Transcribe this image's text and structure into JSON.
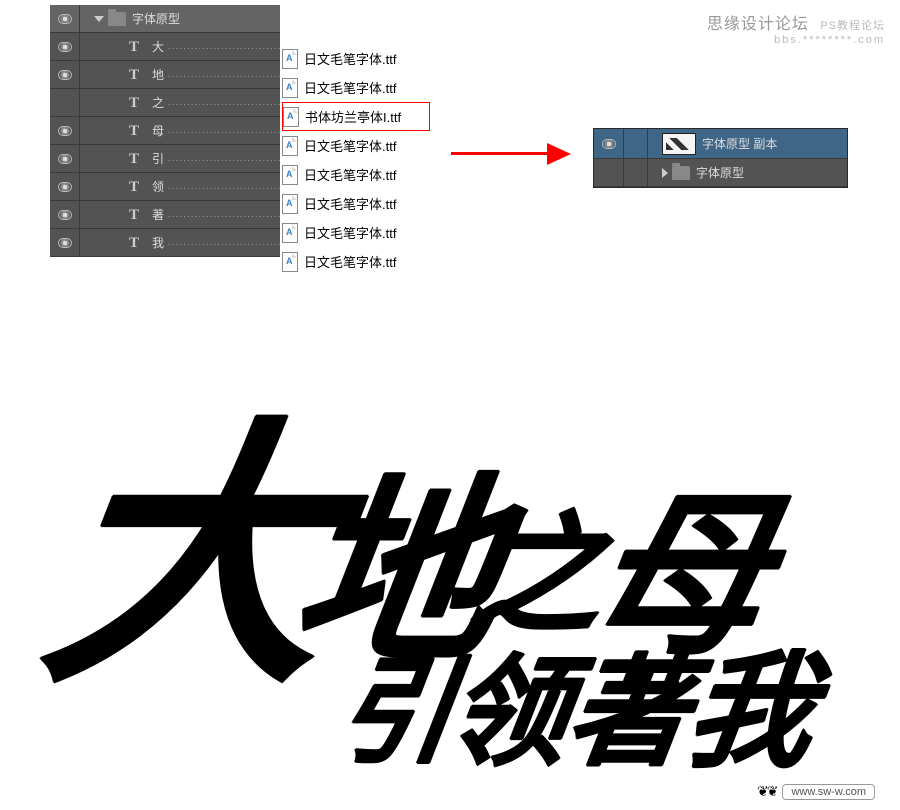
{
  "panel_left": {
    "group_name": "字体原型",
    "layers": [
      {
        "char": "大",
        "font_file": "日文毛笔字体.ttf",
        "highlighted": false
      },
      {
        "char": "地",
        "font_file": "日文毛笔字体.ttf",
        "highlighted": false
      },
      {
        "char": "之",
        "font_file": "书体坊兰亭体I.ttf",
        "highlighted": true
      },
      {
        "char": "母",
        "font_file": "日文毛笔字体.ttf",
        "highlighted": false
      },
      {
        "char": "引",
        "font_file": "日文毛笔字体.ttf",
        "highlighted": false
      },
      {
        "char": "领",
        "font_file": "日文毛笔字体.ttf",
        "highlighted": false
      },
      {
        "char": "著",
        "font_file": "日文毛笔字体.ttf",
        "highlighted": false
      },
      {
        "char": "我",
        "font_file": "日文毛笔字体.ttf",
        "highlighted": false
      }
    ]
  },
  "panel_right": {
    "smart_object_name": "字体原型 副本",
    "group_name": "字体原型"
  },
  "dots_filler": "........................................",
  "calligraphy": {
    "line1": [
      "大",
      "地",
      "之",
      "母"
    ],
    "line2": [
      "引",
      "领",
      "著",
      "我"
    ]
  },
  "watermark_top": {
    "line1": "思缘设计论坛",
    "line2": "bbs.********.com",
    "aux": "PS教程论坛"
  },
  "watermark_bottom": {
    "text": "www.sw-w.com",
    "eyes": "❦❦"
  }
}
